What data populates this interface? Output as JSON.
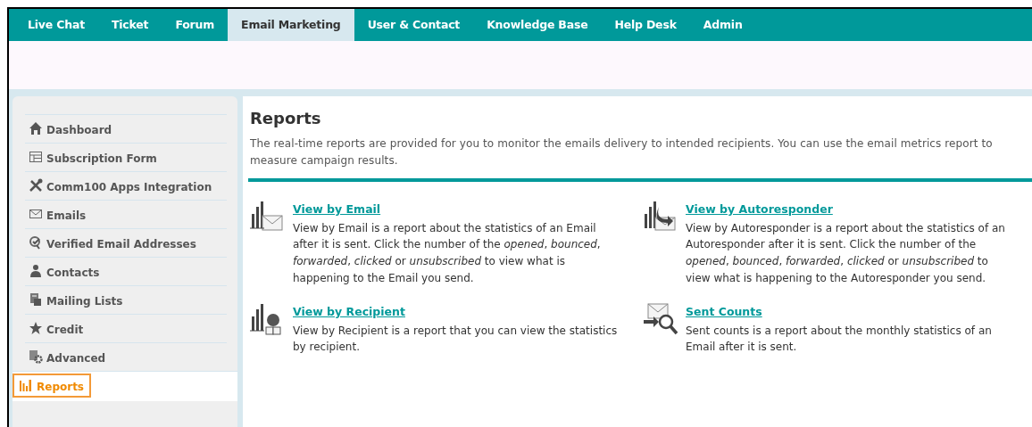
{
  "top_nav": [
    {
      "label": "Live Chat",
      "selected": false
    },
    {
      "label": "Ticket",
      "selected": false
    },
    {
      "label": "Forum",
      "selected": false
    },
    {
      "label": "Email Marketing",
      "selected": true
    },
    {
      "label": "User & Contact",
      "selected": false
    },
    {
      "label": "Knowledge Base",
      "selected": false
    },
    {
      "label": "Help Desk",
      "selected": false
    },
    {
      "label": "Admin",
      "selected": false
    }
  ],
  "sidebar": {
    "items": [
      {
        "label": "Dashboard",
        "selected": false
      },
      {
        "label": "Subscription Form",
        "selected": false
      },
      {
        "label": "Comm100 Apps Integration",
        "selected": false
      },
      {
        "label": "Emails",
        "selected": false
      },
      {
        "label": "Verified Email Addresses",
        "selected": false
      },
      {
        "label": "Contacts",
        "selected": false
      },
      {
        "label": "Mailing Lists",
        "selected": false
      },
      {
        "label": "Credit",
        "selected": false
      },
      {
        "label": "Advanced",
        "selected": false
      },
      {
        "label": "Reports",
        "selected": true
      }
    ]
  },
  "content": {
    "title": "Reports",
    "intro": "The real-time reports are provided for you to monitor the emails delivery to intended recipients. You can use the email metrics report to measure campaign results.",
    "reports": [
      {
        "kind": "email",
        "link": "View by Email",
        "description": "View by Email is a report about the statistics of an Email after it is sent. Click the number of the *opened*, *bounced*, *forwarded*, *clicked* or *unsubscribed* to view what is happening to the Email you send."
      },
      {
        "kind": "autoresponder",
        "link": "View by Autoresponder",
        "description": "View by Autoresponder is a report about the statistics of an Autoresponder after it is sent. Click the number of the *opened*, *bounced*, *forwarded*, *clicked* or *unsubscribed* to view what is happening to the Autoresponder you send."
      },
      {
        "kind": "recipient",
        "link": "View by Recipient",
        "description": "View by Recipient is a report that you can view the statistics by recipient."
      },
      {
        "kind": "sent",
        "link": "Sent Counts",
        "description": "Sent counts is a report about the monthly statistics of an Email after it is sent."
      }
    ]
  }
}
